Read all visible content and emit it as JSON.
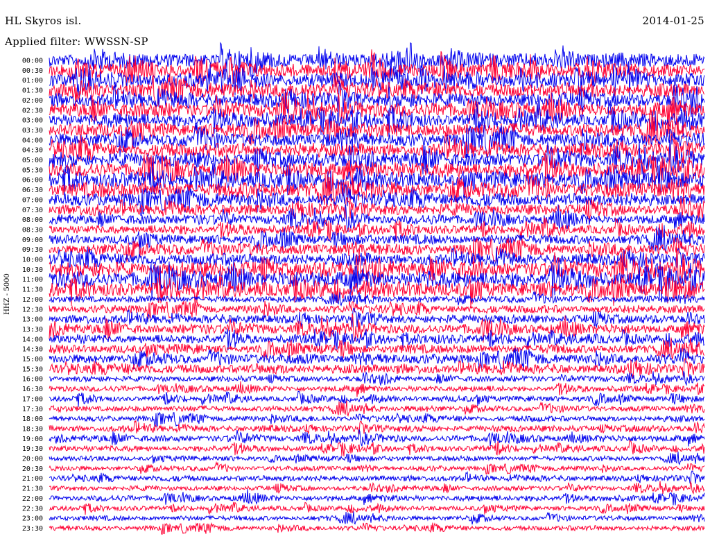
{
  "header": {
    "station": "HL Skyros isl.",
    "date": "2014-01-25",
    "filter": "Applied filter: WWSSN-SP"
  },
  "chart_data": {
    "type": "line",
    "title": "HL Skyros isl.",
    "date": "2014-01-25",
    "filter": "Applied filter: WWSSN-SP",
    "ylabel": "HHZ - 5000",
    "series_colors": [
      "#0000ee",
      "#ff0033"
    ],
    "rows": [
      {
        "label": "00:00",
        "amp": 0.9
      },
      {
        "label": "00:30",
        "amp": 0.9
      },
      {
        "label": "01:00",
        "amp": 0.9
      },
      {
        "label": "01:30",
        "amp": 0.9
      },
      {
        "label": "02:00",
        "amp": 0.9
      },
      {
        "label": "02:30",
        "amp": 0.9
      },
      {
        "label": "03:00",
        "amp": 0.85
      },
      {
        "label": "03:30",
        "amp": 0.85
      },
      {
        "label": "04:00",
        "amp": 0.85
      },
      {
        "label": "04:30",
        "amp": 0.85
      },
      {
        "label": "05:00",
        "amp": 0.9
      },
      {
        "label": "05:30",
        "amp": 0.95
      },
      {
        "label": "06:00",
        "amp": 0.95
      },
      {
        "label": "06:30",
        "amp": 0.95
      },
      {
        "label": "07:00",
        "amp": 0.8
      },
      {
        "label": "07:30",
        "amp": 0.7
      },
      {
        "label": "08:00",
        "amp": 0.6
      },
      {
        "label": "08:30",
        "amp": 0.55
      },
      {
        "label": "09:00",
        "amp": 0.6
      },
      {
        "label": "09:30",
        "amp": 0.7
      },
      {
        "label": "10:00",
        "amp": 0.75
      },
      {
        "label": "10:30",
        "amp": 0.95
      },
      {
        "label": "11:00",
        "amp": 1.0
      },
      {
        "label": "11:30",
        "amp": 0.9
      },
      {
        "label": "12:00",
        "amp": 0.4
      },
      {
        "label": "12:30",
        "amp": 0.5
      },
      {
        "label": "13:00",
        "amp": 0.55
      },
      {
        "label": "13:30",
        "amp": 0.6
      },
      {
        "label": "14:00",
        "amp": 0.55
      },
      {
        "label": "14:30",
        "amp": 0.55
      },
      {
        "label": "15:00",
        "amp": 0.6
      },
      {
        "label": "15:30",
        "amp": 0.6
      },
      {
        "label": "16:00",
        "amp": 0.35
      },
      {
        "label": "16:30",
        "amp": 0.35
      },
      {
        "label": "17:00",
        "amp": 0.35
      },
      {
        "label": "17:30",
        "amp": 0.35
      },
      {
        "label": "18:00",
        "amp": 0.35
      },
      {
        "label": "18:30",
        "amp": 0.4
      },
      {
        "label": "19:00",
        "amp": 0.4
      },
      {
        "label": "19:30",
        "amp": 0.35
      },
      {
        "label": "20:00",
        "amp": 0.3
      },
      {
        "label": "20:30",
        "amp": 0.3
      },
      {
        "label": "21:00",
        "amp": 0.35
      },
      {
        "label": "21:30",
        "amp": 0.3
      },
      {
        "label": "22:00",
        "amp": 0.35
      },
      {
        "label": "22:30",
        "amp": 0.3
      },
      {
        "label": "23:00",
        "amp": 0.3
      },
      {
        "label": "23:30",
        "amp": 0.3
      }
    ]
  }
}
